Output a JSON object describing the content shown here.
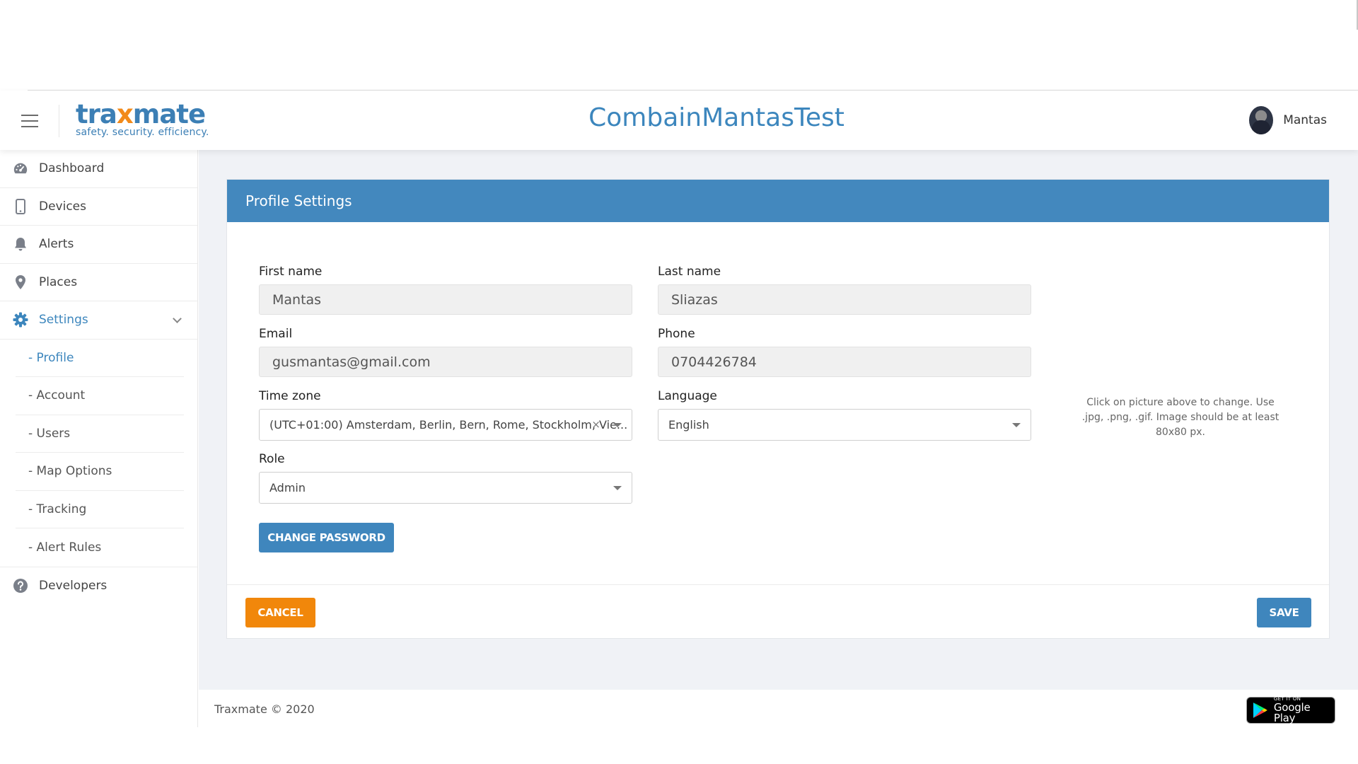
{
  "header": {
    "logo_prefix": "tra",
    "logo_x": "x",
    "logo_suffix": "mate",
    "logo_tagline": "safety. security. efficiency.",
    "org_title": "CombainMantasTest",
    "user_name": "Mantas"
  },
  "sidebar": {
    "items": [
      {
        "label": "Dashboard",
        "icon": "dashboard-icon"
      },
      {
        "label": "Devices",
        "icon": "mobile-device-icon"
      },
      {
        "label": "Alerts",
        "icon": "bell-icon"
      },
      {
        "label": "Places",
        "icon": "map-pin-icon"
      },
      {
        "label": "Settings",
        "icon": "gear-icon"
      }
    ],
    "settings_sub": [
      {
        "label": "- Profile"
      },
      {
        "label": "- Account"
      },
      {
        "label": "- Users"
      },
      {
        "label": "- Map Options"
      },
      {
        "label": "- Tracking"
      },
      {
        "label": "- Alert Rules"
      }
    ],
    "developers": {
      "label": "Developers",
      "icon": "help-circle-icon"
    }
  },
  "card": {
    "title": "Profile Settings",
    "first_name_label": "First name",
    "first_name_value": "Mantas",
    "last_name_label": "Last name",
    "last_name_value": "Sliazas",
    "email_label": "Email",
    "email_value": "gusmantas@gmail.com",
    "phone_label": "Phone",
    "phone_value": "0704426784",
    "timezone_label": "Time zone",
    "timezone_value": "(UTC+01:00) Amsterdam, Berlin, Bern, Rome, Stockholm, Vie...",
    "language_label": "Language",
    "language_value": "English",
    "role_label": "Role",
    "role_value": "Admin",
    "change_password_label": "CHANGE PASSWORD",
    "picture_hint": "Click on picture above to change. Use .jpg, .png, .gif. Image should be at least 80x80 px.",
    "cancel_label": "CANCEL",
    "save_label": "SAVE"
  },
  "footer": {
    "copyright": "Traxmate © 2020",
    "gplay_small": "GET IT ON",
    "gplay_big": "Google Play"
  },
  "colors": {
    "brand_blue": "#4388be",
    "accent_orange": "#f1870b",
    "active_link": "#3c86bd"
  }
}
